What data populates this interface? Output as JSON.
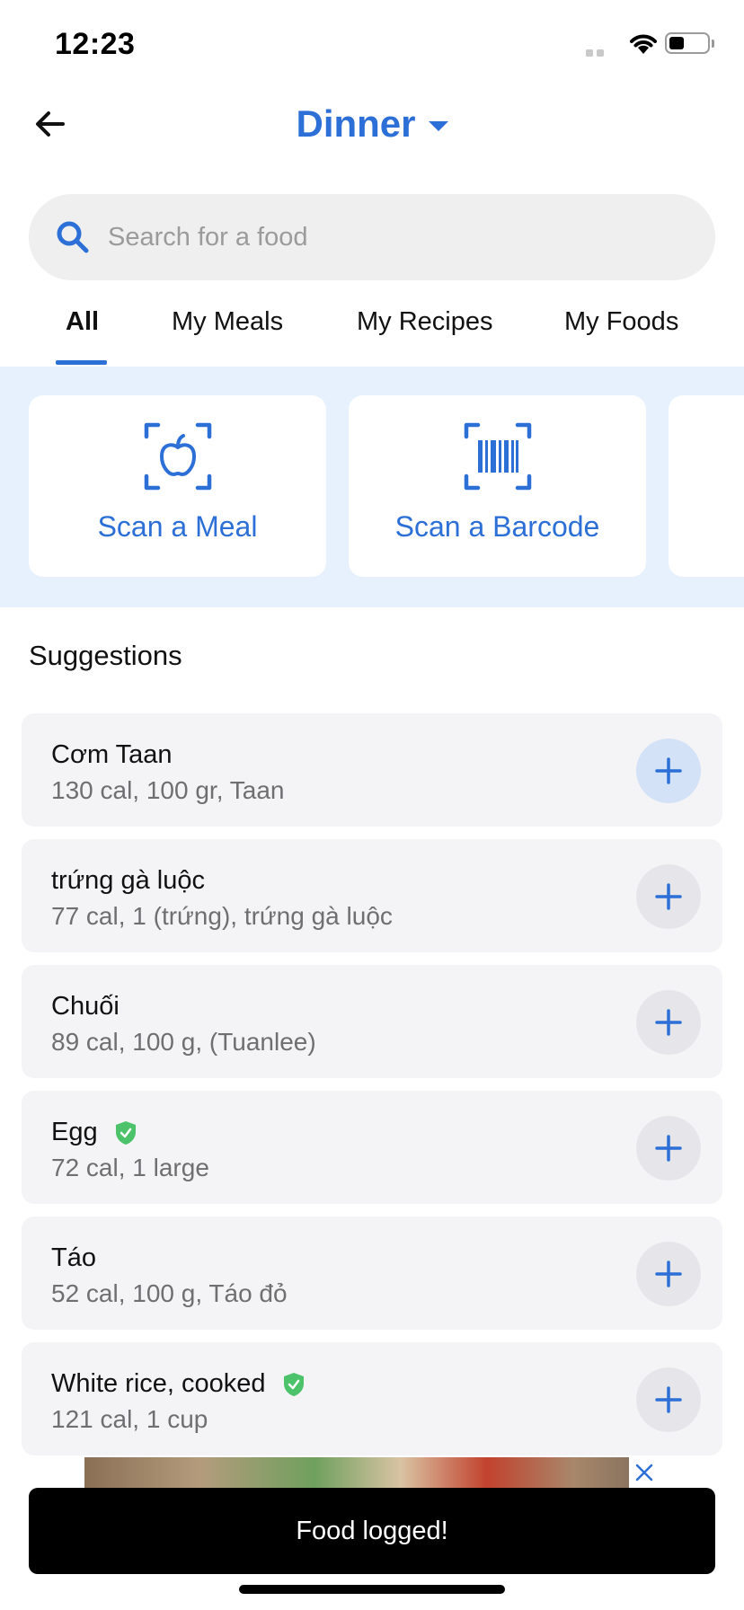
{
  "status_bar": {
    "time": "12:23",
    "battery_level": 0.4
  },
  "header": {
    "meal": "Dinner",
    "back_icon": "arrow-left-icon",
    "caret_icon": "caret-down-icon"
  },
  "search": {
    "placeholder": "Search for a food",
    "value": "",
    "icon": "search-icon"
  },
  "tabs": [
    {
      "label": "All",
      "active": true
    },
    {
      "label": "My Meals",
      "active": false
    },
    {
      "label": "My Recipes",
      "active": false
    },
    {
      "label": "My Foods",
      "active": false
    }
  ],
  "scan_cards": [
    {
      "label": "Scan a Meal",
      "icon": "apple-scan-icon"
    },
    {
      "label": "Scan a Barcode",
      "icon": "barcode-scan-icon"
    }
  ],
  "suggestions": {
    "title": "Suggestions",
    "items": [
      {
        "name": "Cơm Taan",
        "detail": "130 cal, 100 gr, Taan",
        "verified": false
      },
      {
        "name": "trứng gà luộc",
        "detail": "77 cal, 1 (trứng), trứng gà luộc",
        "verified": false
      },
      {
        "name": "Chuối",
        "detail": "89 cal, 100 g, (Tuanlee)",
        "verified": false
      },
      {
        "name": "Egg",
        "detail": "72 cal, 1 large",
        "verified": true
      },
      {
        "name": "Táo",
        "detail": "52 cal, 100 g, Táo đỏ",
        "verified": false
      },
      {
        "name": "White rice, cooked",
        "detail": "121 cal, 1 cup",
        "verified": true
      }
    ]
  },
  "toast": {
    "message": "Food logged!"
  },
  "colors": {
    "accent": "#2c6fd6",
    "scan_bg": "#e6f1fd",
    "verified": "#4cc36b",
    "toast_bg": "#000000"
  }
}
